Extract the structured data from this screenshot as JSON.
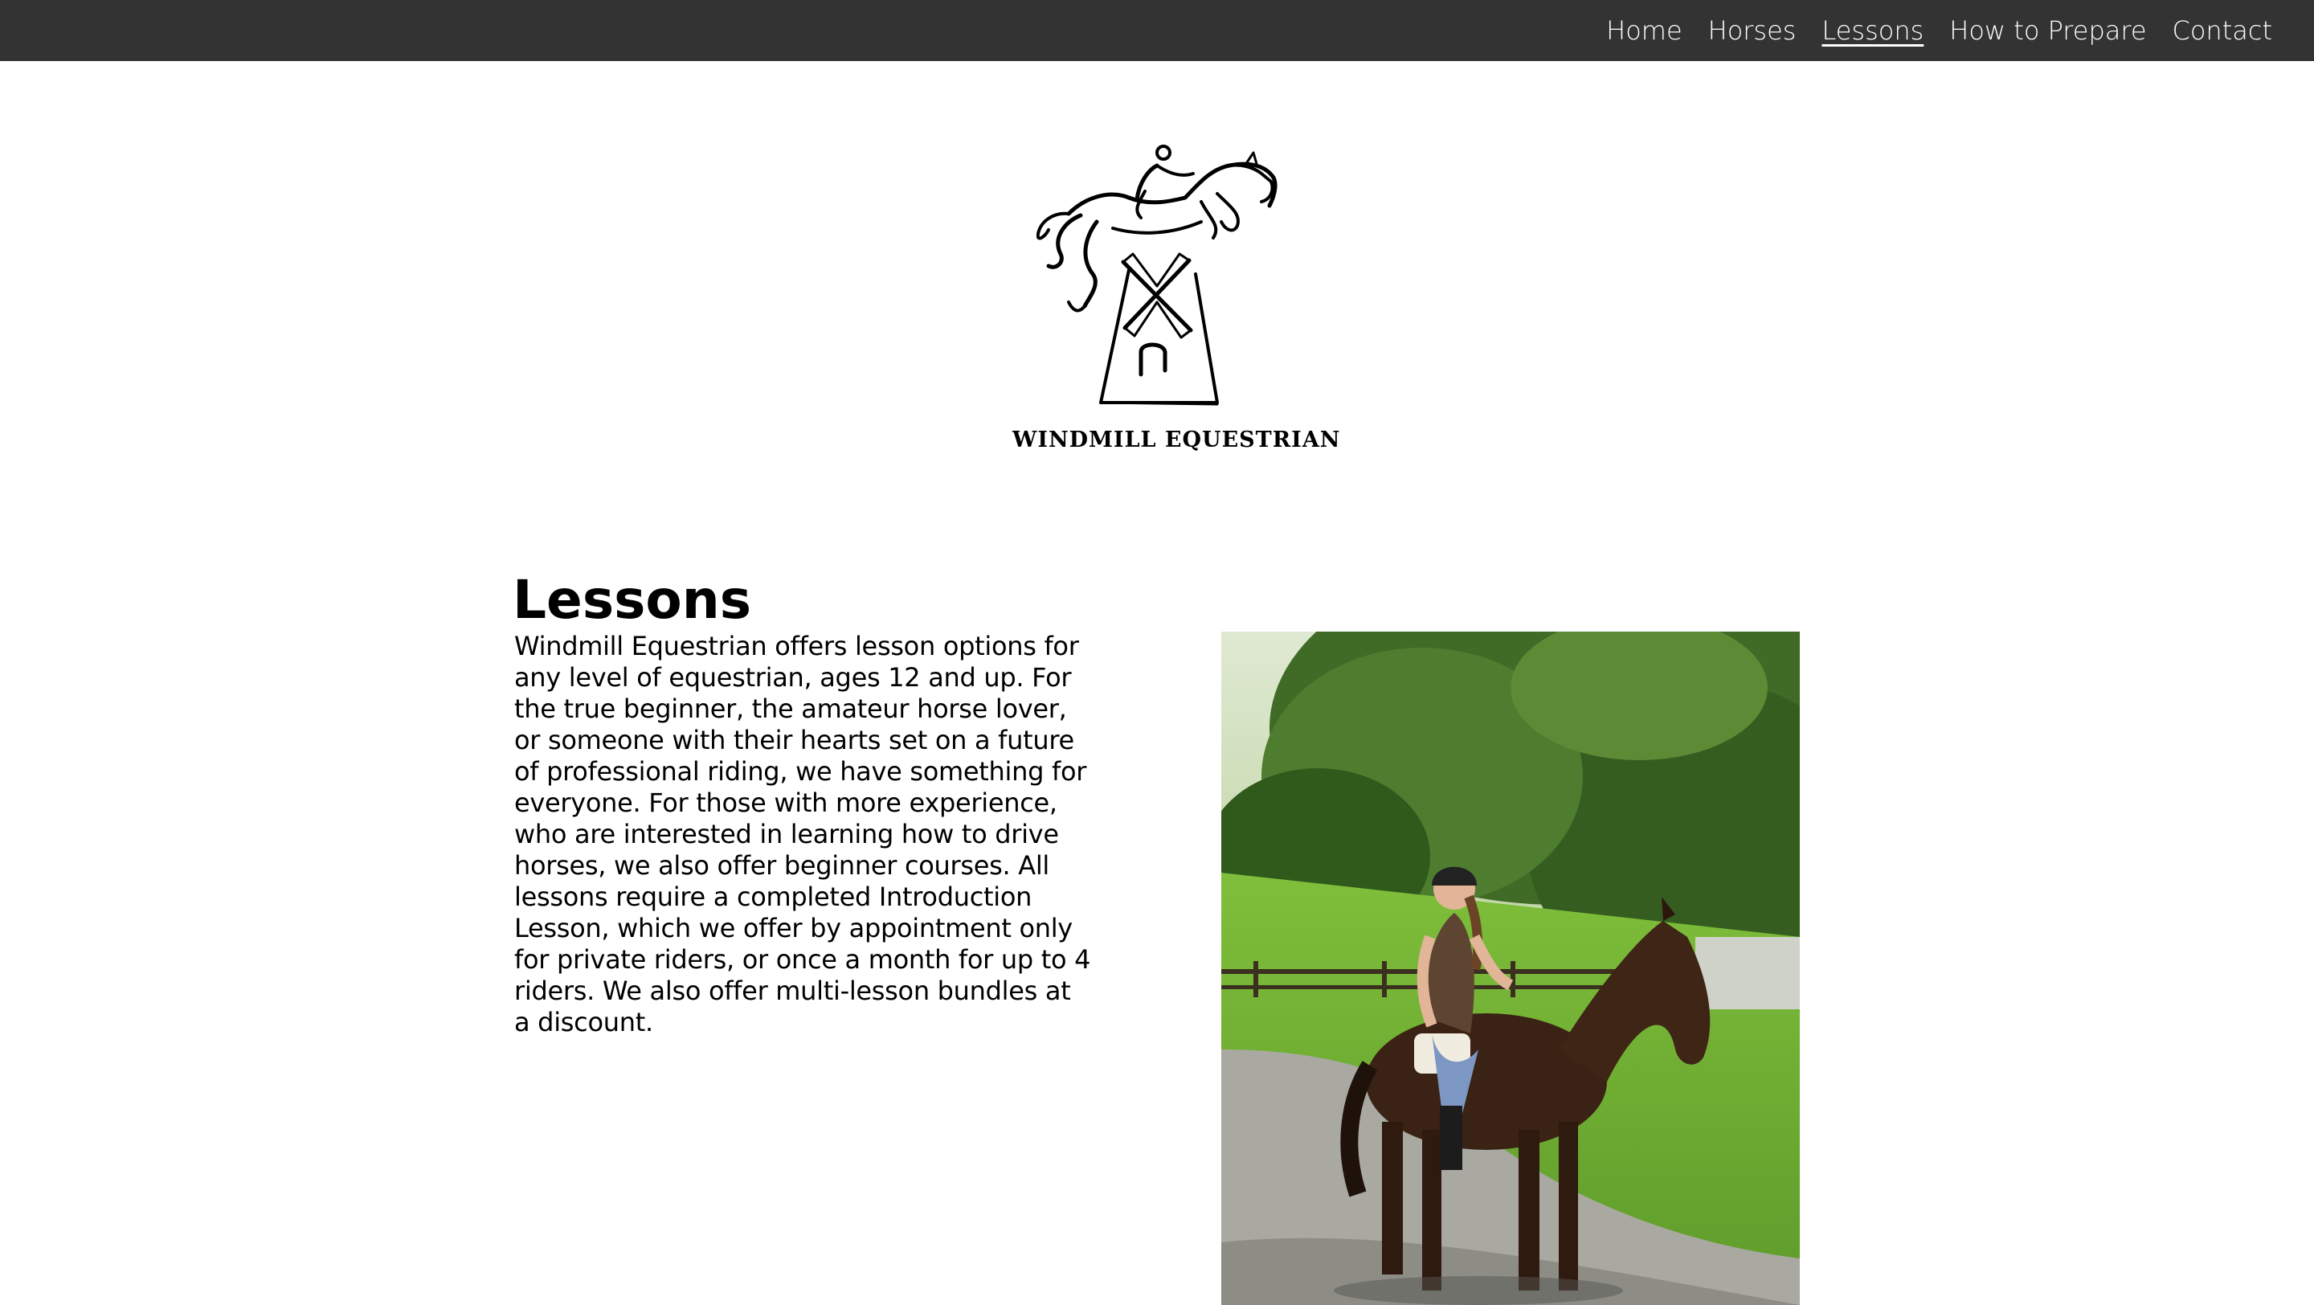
{
  "nav": {
    "items": [
      {
        "label": "Home",
        "active": false
      },
      {
        "label": "Horses",
        "active": false
      },
      {
        "label": "Lessons",
        "active": true
      },
      {
        "label": "How to Prepare",
        "active": false
      },
      {
        "label": "Contact",
        "active": false
      }
    ]
  },
  "logo": {
    "text": "WINDMILL EQUESTRIAN",
    "icon": "horse-jumping-windmill-logo"
  },
  "main": {
    "heading": "Lessons",
    "body": "Windmill Equestrian offers lesson options for any level of equestrian, ages 12 and up. For the true beginner, the amateur horse lover, or someone with their hearts set on a future of professional riding, we have something for everyone. For those with more experience, who are interested in learning how to drive horses, we also offer beginner courses. All lessons require a completed Introduction Lesson, which we offer by appointment only for private riders, or once a month for up to 4 riders. We also offer multi-lesson bundles at a discount."
  },
  "photo": {
    "subject": "rider-on-brown-horse-photo"
  },
  "colors": {
    "topbar": "#333333",
    "nav_text": "#ffffff",
    "page_bg": "#ffffff",
    "text": "#000000"
  }
}
